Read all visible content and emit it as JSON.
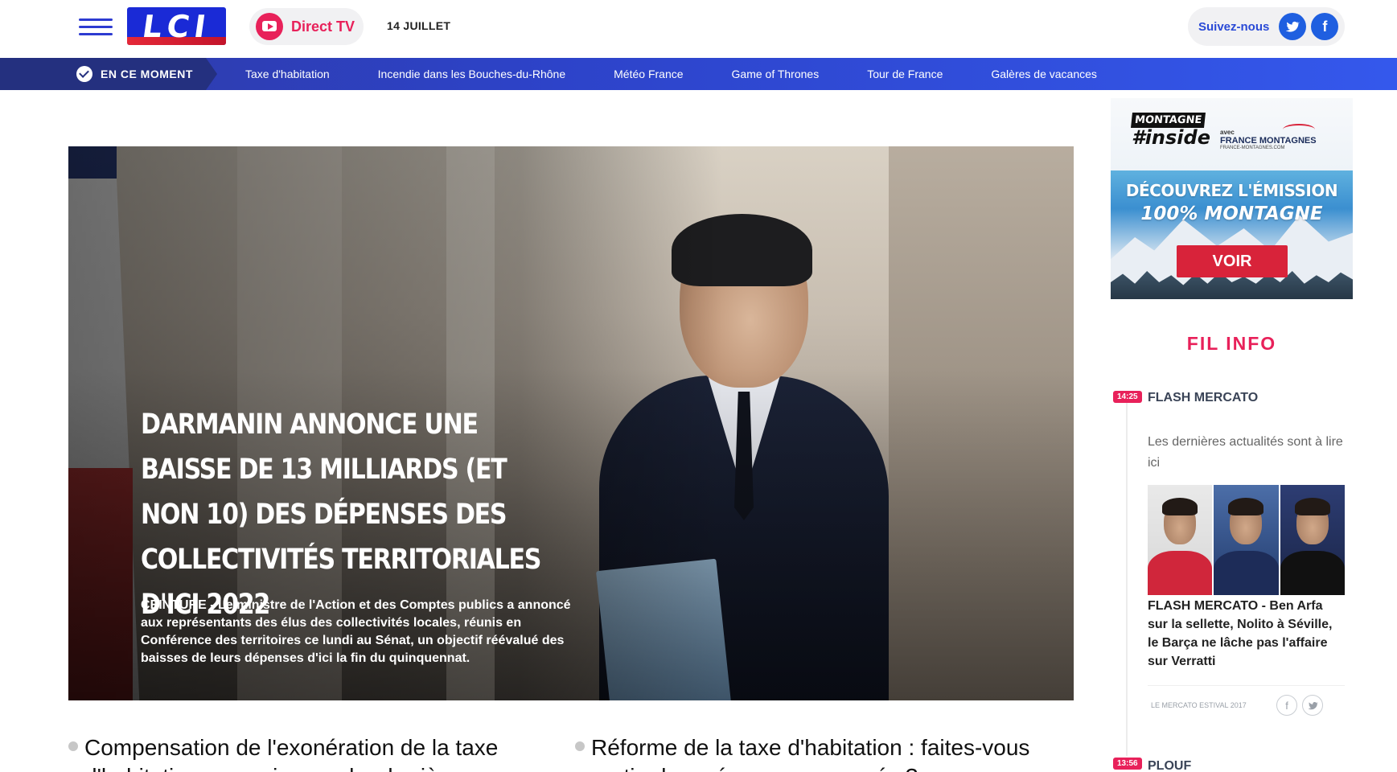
{
  "header": {
    "logo_text": "LCI",
    "direct_label": "Direct TV",
    "date": "14 JUILLET",
    "follow_label": "Suivez-nous",
    "social": [
      {
        "icon": "twitter-icon"
      },
      {
        "icon": "facebook-icon",
        "glyph": "f"
      }
    ]
  },
  "trending": {
    "label": "EN CE MOMENT",
    "links": [
      "Taxe d'habitation",
      "Incendie dans les Bouches-du-Rhône",
      "Météo France",
      "Game of Thrones",
      "Tour de France",
      "Galères de vacances"
    ]
  },
  "hero": {
    "title": "DARMANIN ANNONCE UNE BAISSE DE 13 MILLIARDS (ET NON 10) DES DÉPENSES DES COLLECTIVITÉS TERRITORIALES D'ICI 2022",
    "kicker": "CEINTURE",
    "lead": " - Le ministre de l'Action et des Comptes publics a annoncé aux représentants des élus des collectivités locales, réunis en Conférence des territoires ce lundi au Sénat, un objectif réévalué des baisses de leurs dépenses d'ici la fin du quinquennat."
  },
  "articles": [
    {
      "headline": "Compensation de l'exonération de la taxe d'habitation : ce qui se cache derrière"
    },
    {
      "headline": "Réforme de la taxe d'habitation : faites-vous partie des ménages concernés ?"
    }
  ],
  "ad": {
    "brand_top": "MONTAGNE",
    "brand_hash": "#inside",
    "partner_prefix": "avec",
    "partner": "FRANCE MONTAGNES",
    "partner_url": "FRANCE-MONTAGNES.COM",
    "line1": "DÉCOUVREZ L'ÉMISSION",
    "line2": "100% MONTAGNE",
    "cta": "VOIR"
  },
  "fil_info": {
    "title": "FIL INFO",
    "items": [
      {
        "time": "14:25",
        "category": "FLASH MERCATO",
        "description": "Les dernières actualités sont à lire ici",
        "story": "FLASH MERCATO - Ben Arfa sur la sellette, Nolito à Séville, le Barça ne lâche pas l'affaire sur Verratti",
        "tag": "LE MERCATO ESTIVAL 2017"
      },
      {
        "time": "13:56",
        "category": "PLOUF"
      }
    ]
  },
  "colors": {
    "brand_blue": "#2d3bd1",
    "accent_pink": "#e8215a",
    "trend_bar": "#2d43c9"
  }
}
